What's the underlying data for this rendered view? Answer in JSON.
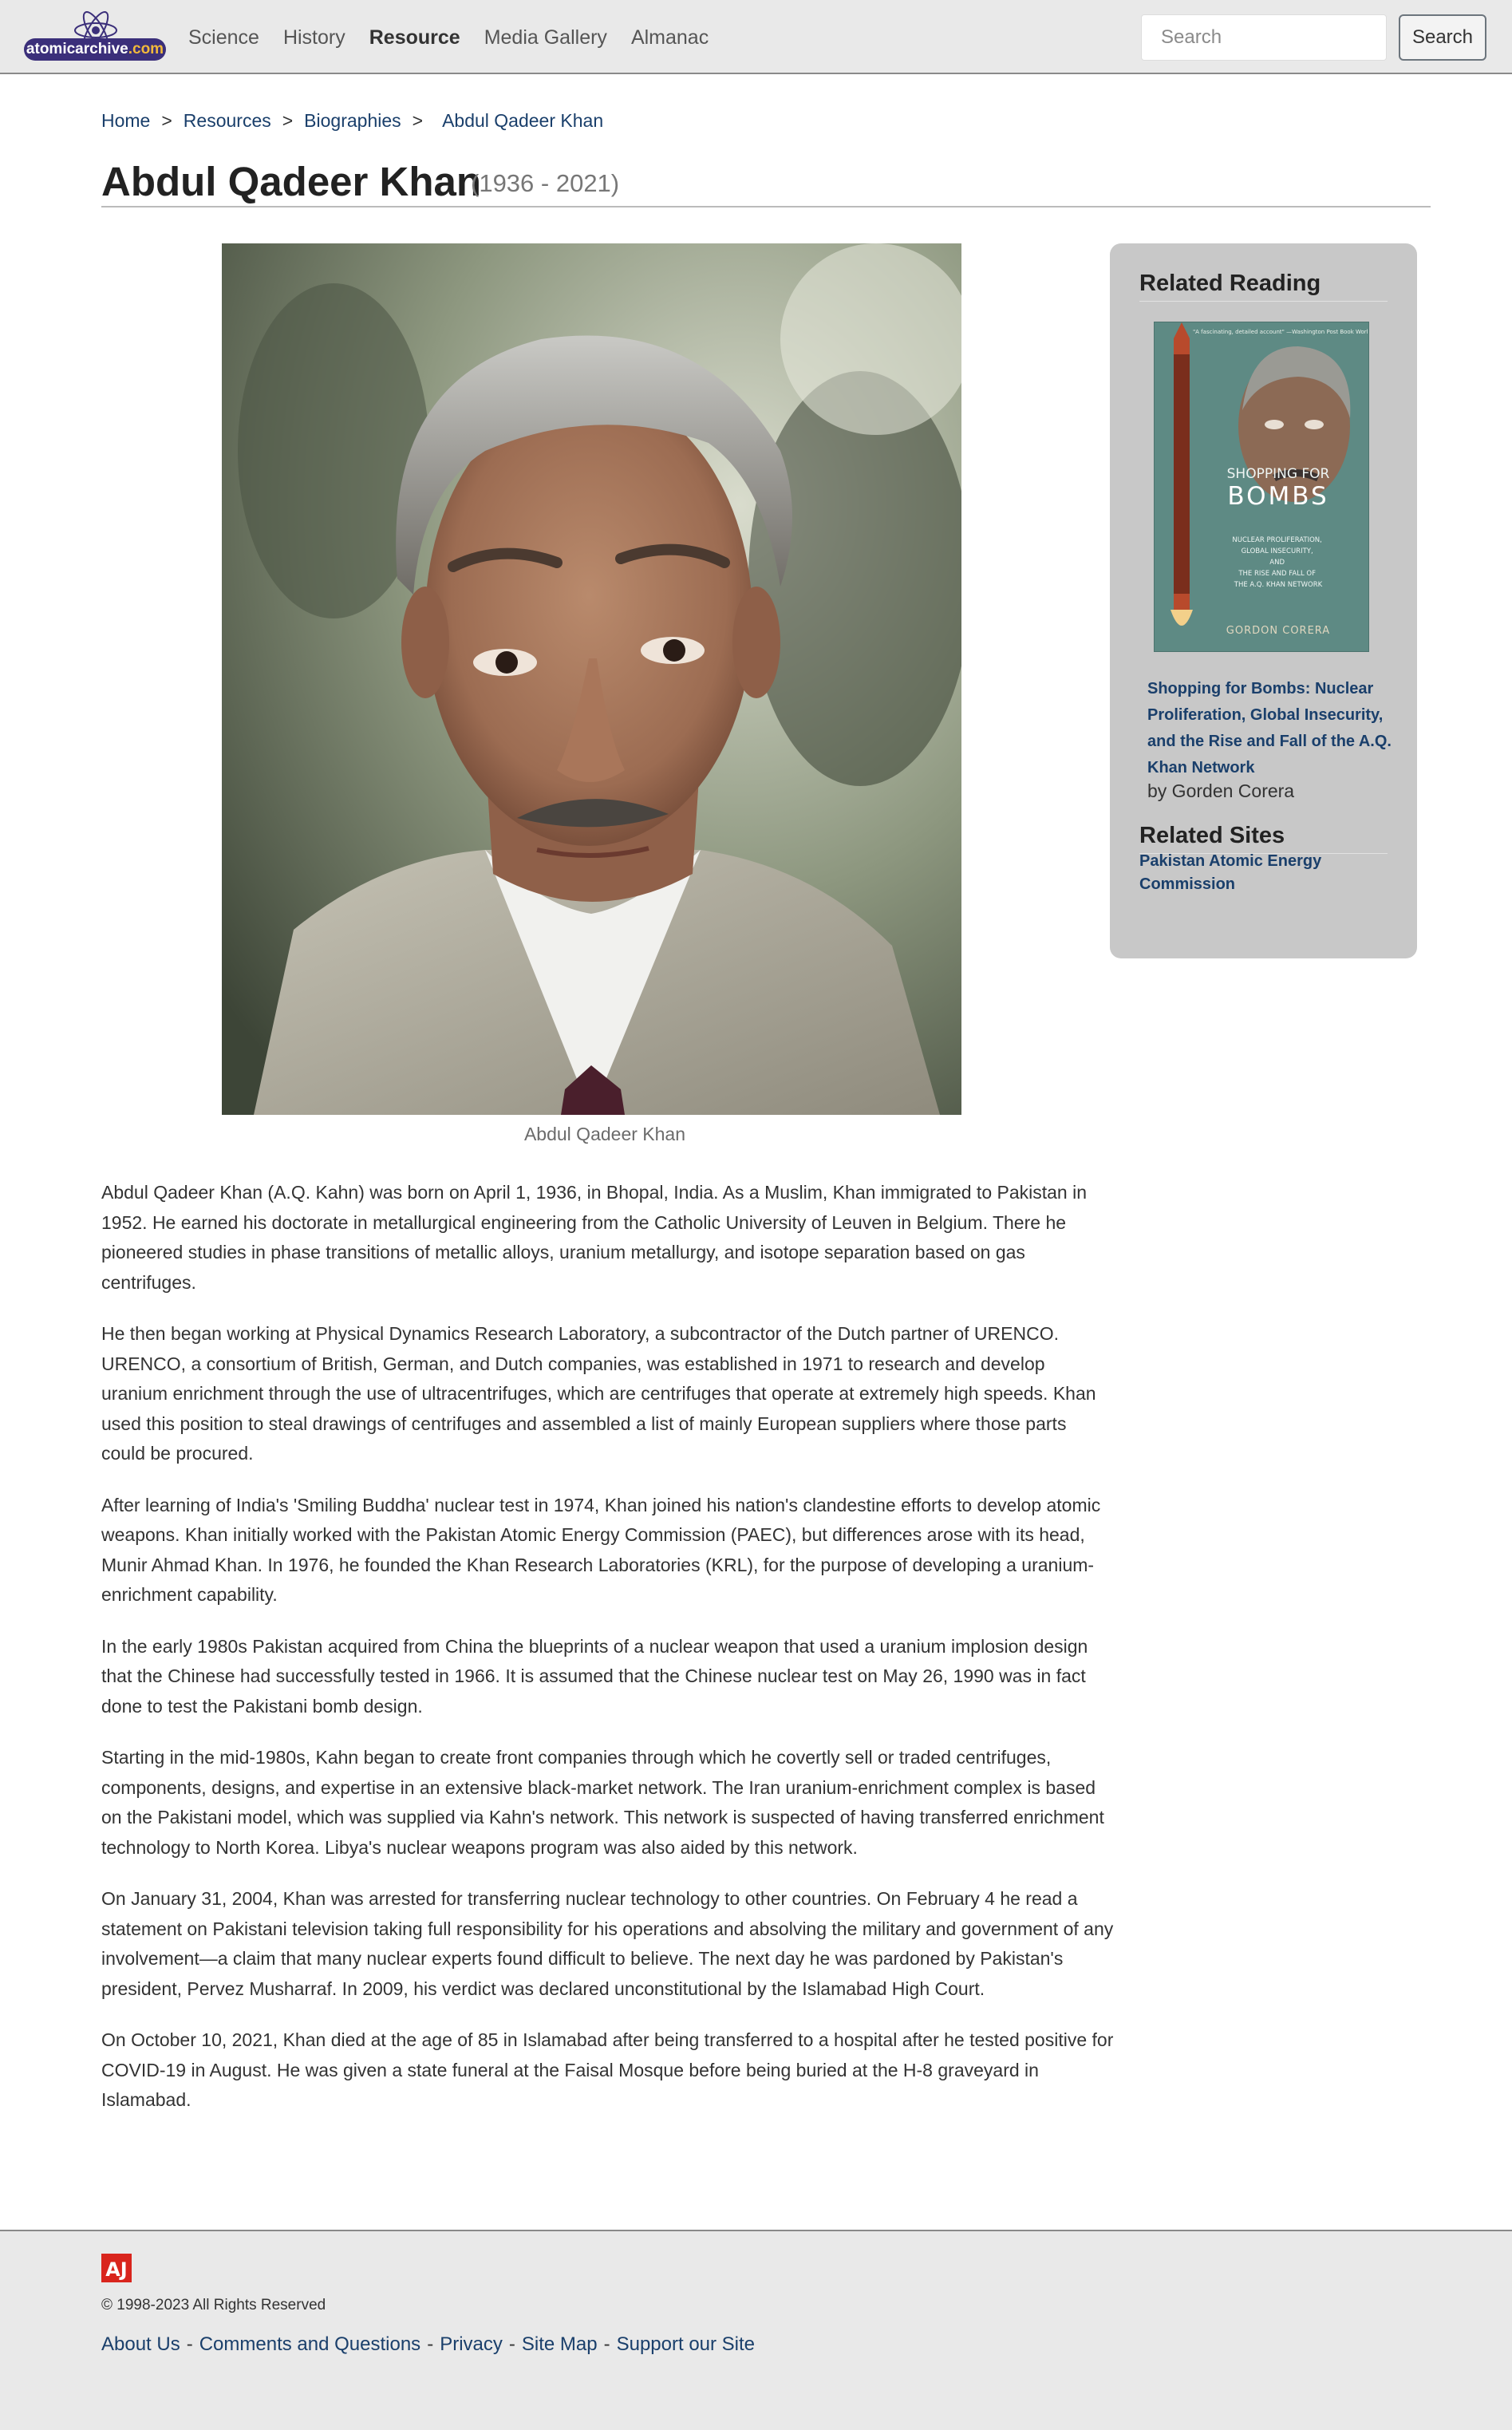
{
  "header": {
    "logo_text_main": "atomicarchive",
    "logo_text_dotcom": ".com",
    "nav": [
      {
        "label": "Science"
      },
      {
        "label": "History"
      },
      {
        "label": "Resource"
      },
      {
        "label": "Media Gallery"
      },
      {
        "label": "Almanac"
      }
    ],
    "active_nav": "Resource",
    "search_placeholder": "Search",
    "search_button": "Search"
  },
  "breadcrumb": {
    "items": [
      "Home",
      "Resources",
      "Biographies"
    ],
    "separator": ">",
    "current": "Abdul Qadeer Khan"
  },
  "page": {
    "title": "Abdul Qadeer Khan",
    "dates": "(1936 - 2021)",
    "image_caption": "Abdul Qadeer Khan"
  },
  "sidebar": {
    "related_reading_heading": "Related Reading",
    "book": {
      "cover_quote": "\"A fascinating, detailed account\" —Washington Post Book World",
      "cover_title_line1": "SHOPPING FOR",
      "cover_title_line2": "BOMBS",
      "cover_subtitle": "Nuclear Proliferation, Global Insecurity, and the Rise and Fall of the A.Q. Khan Network",
      "cover_author": "GORDON CORERA",
      "title": "Shopping for Bombs: Nuclear Proliferation, Global Insecurity, and the Rise and Fall of the A.Q. Khan Network",
      "author": "by Gorden Corera"
    },
    "related_sites_heading": "Related Sites",
    "related_sites": [
      "Pakistan Atomic Energy Commission"
    ]
  },
  "article": {
    "paragraphs": [
      "Abdul Qadeer Khan (A.Q. Kahn) was born on April 1, 1936, in Bhopal, India. As a Muslim, Khan immigrated to Pakistan in 1952. He earned his doctorate in metallurgical engineering from the Catholic University of Leuven in Belgium. There he pioneered studies in phase transitions of metallic alloys, uranium metallurgy, and isotope separation based on gas centrifuges.",
      "He then began working at Physical Dynamics Research Laboratory, a subcontractor of the Dutch partner of URENCO. URENCO, a consortium of British, German, and Dutch companies, was established in 1971 to research and develop uranium enrichment through the use of ultracentrifuges, which are centrifuges that operate at extremely high speeds. Khan used this position to steal drawings of centrifuges and assembled a list of mainly European suppliers where those parts could be procured.",
      "After learning of India's 'Smiling Buddha' nuclear test in 1974, Khan joined his nation's clandestine efforts to develop atomic weapons. Khan initially worked with the Pakistan Atomic Energy Commission (PAEC), but differences arose with its head, Munir Ahmad Khan. In 1976, he founded the Khan Research Laboratories (KRL), for the purpose of developing a uranium-enrichment capability.",
      "In the early 1980s Pakistan acquired from China the blueprints of a nuclear weapon that used a uranium implosion design that the Chinese had successfully tested in 1966. It is assumed that the Chinese nuclear test on May 26, 1990 was in fact done to test the Pakistani bomb design.",
      "Starting in the mid-1980s, Kahn began to create front companies through which he covertly sell or traded centrifuges, components, designs, and expertise in an extensive black-market network. The Iran uranium-enrichment complex is based on the Pakistani model, which was supplied via Kahn's network. This network is suspected of having transferred enrichment technology to North Korea. Libya's nuclear weapons program was also aided by this network.",
      "On January 31, 2004, Khan was arrested for transferring nuclear technology to other countries. On February 4 he read a statement on Pakistani television taking full responsibility for his operations and absolving the military and government of any involvement—a claim that many nuclear experts found difficult to believe. The next day he was pardoned by Pakistan's president, Pervez Musharraf. In 2009, his verdict was declared unconstitutional by the Islamabad High Court.",
      "On October 10, 2021, Khan died at the age of 85 in Islamabad after being transferred to a hospital after he tested positive for COVID-19 in August. He was given a state funeral at the Faisal Mosque before being buried at the H-8 graveyard in Islamabad."
    ]
  },
  "footer": {
    "logo_text": "AJ",
    "copyright": "© 1998-2023 All Rights Reserved",
    "links": [
      "About Us",
      "Comments and Questions",
      "Privacy",
      "Site Map",
      "Support our Site"
    ],
    "link_separator": "-"
  },
  "colors": {
    "link": "#1a3f6b",
    "header_bg": "#e9e9e9",
    "sidebar_bg": "#c8c8c8",
    "logo_pill": "#3b2f7a",
    "logo_dotcom": "#f2b93b",
    "footer_logo": "#d9251d"
  }
}
